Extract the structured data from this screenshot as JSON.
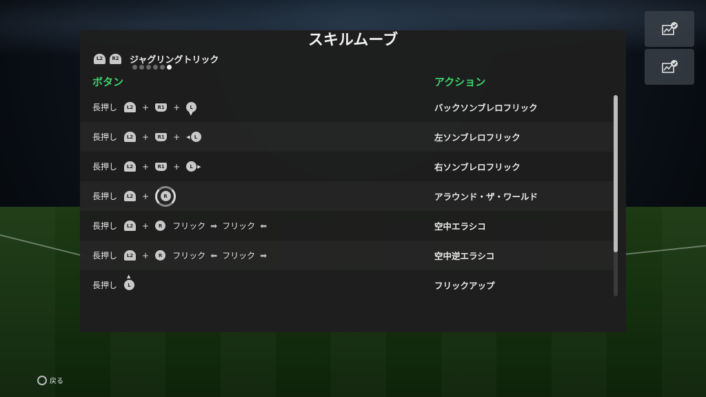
{
  "title": "スキルムーブ",
  "category": {
    "trigger_left": "L2",
    "trigger_right": "R2",
    "name": "ジャグリングトリック",
    "page_count": 6,
    "active_page": 6
  },
  "headers": {
    "button": "ボタン",
    "action": "アクション"
  },
  "rows": [
    {
      "hold": "長押し",
      "l2": "L2",
      "r1": "R1",
      "stick": "L",
      "action": "バックソンブレロフリック"
    },
    {
      "hold": "長押し",
      "l2": "L2",
      "r1": "R1",
      "stick": "L",
      "action": "左ソンブレロフリック"
    },
    {
      "hold": "長押し",
      "l2": "L2",
      "r1": "R1",
      "stick": "L",
      "action": "右ソンブレロフリック"
    },
    {
      "hold": "長押し",
      "l2": "L2",
      "stick": "R",
      "action": "アラウンド・ザ・ワールド"
    },
    {
      "hold": "長押し",
      "l2": "L2",
      "stick": "R",
      "word1": "フリック",
      "word2": "フリック",
      "action": "空中エラシコ"
    },
    {
      "hold": "長押し",
      "l2": "L2",
      "stick": "R",
      "word1": "フリック",
      "word2": "フリック",
      "action": "空中逆エラシコ"
    },
    {
      "hold": "長押し",
      "stick": "L",
      "action": "フリックアップ"
    }
  ],
  "footer": {
    "back_label": "戻る"
  },
  "icons": {
    "side1": "chart-check-icon",
    "side2": "chart-check-icon",
    "back": "circle-button-icon"
  },
  "colors": {
    "accent": "#3dd66b",
    "panel": "#1e1e1e"
  }
}
